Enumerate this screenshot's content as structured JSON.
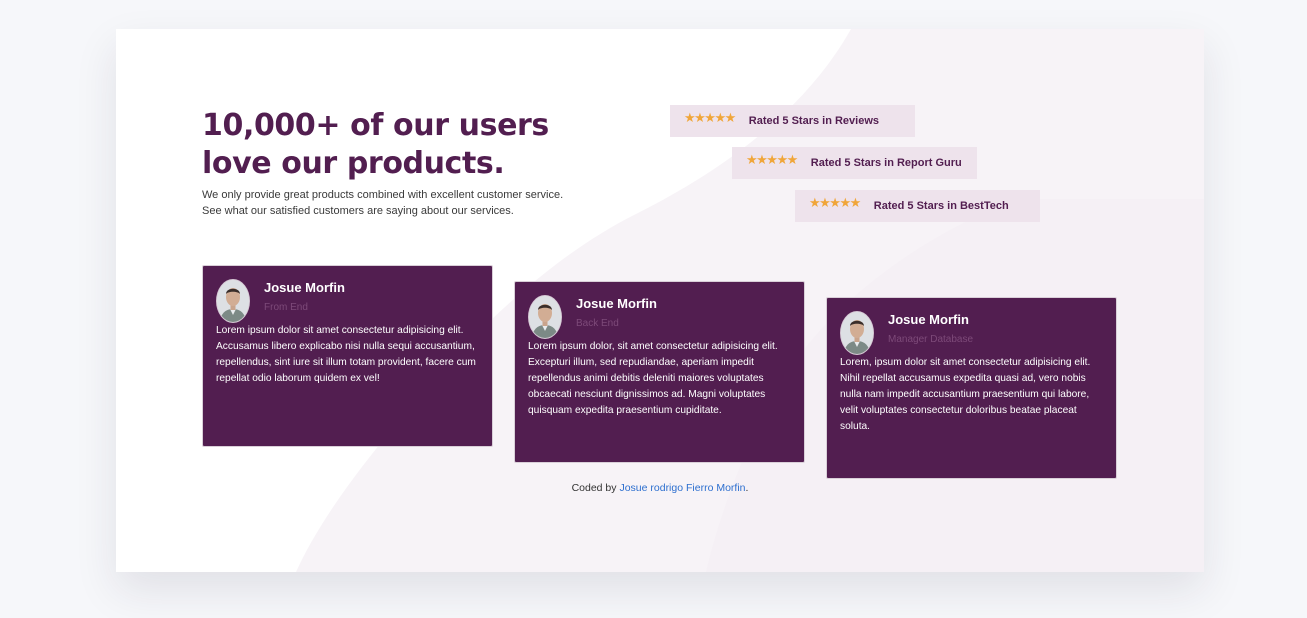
{
  "hero": {
    "headline_line1": "10,000+ of our users",
    "headline_line2": "love our products.",
    "intro": "We only provide great products combined with excellent customer service. See what our satisfied customers are saying about our services."
  },
  "ratings": [
    {
      "stars": "★★★★★",
      "label": "Rated 5 Stars in Reviews"
    },
    {
      "stars": "★★★★★",
      "label": "Rated 5 Stars in Report Guru"
    },
    {
      "stars": "★★★★★",
      "label": "Rated 5 Stars in BestTech"
    }
  ],
  "testimonials": [
    {
      "name": "Josue Morfin",
      "role": "From End",
      "text": "Lorem ipsum dolor sit amet consectetur adipisicing elit. Accusamus libero explicabo nisi nulla sequi accusantium, repellendus, sint iure sit illum totam provident, facere cum repellat odio laborum quidem ex vel!"
    },
    {
      "name": "Josue Morfin",
      "role": "Back End",
      "text": "Lorem ipsum dolor, sit amet consectetur adipisicing elit. Excepturi illum, sed repudiandae, aperiam impedit repellendus animi debitis deleniti maiores voluptates obcaecati nesciunt dignissimos ad. Magni voluptates quisquam expedita praesentium cupiditate."
    },
    {
      "name": "Josue Morfin",
      "role": "Manager Database",
      "text": "Lorem, ipsum dolor sit amet consectetur adipisicing elit. Nihil repellat accusamus expedita quasi ad, vero nobis nulla nam impedit accusantium praesentium qui labore, velit voluptates consectetur doloribus beatae placeat soluta."
    }
  ],
  "footer": {
    "prefix": "Coded by ",
    "link_text": "Josue rodrigo Fierro Morfin",
    "suffix": "."
  },
  "colors": {
    "brand": "#521e50",
    "rating_bg": "#eee3ec",
    "star": "#f0a63a",
    "link": "#2d6fcf"
  }
}
